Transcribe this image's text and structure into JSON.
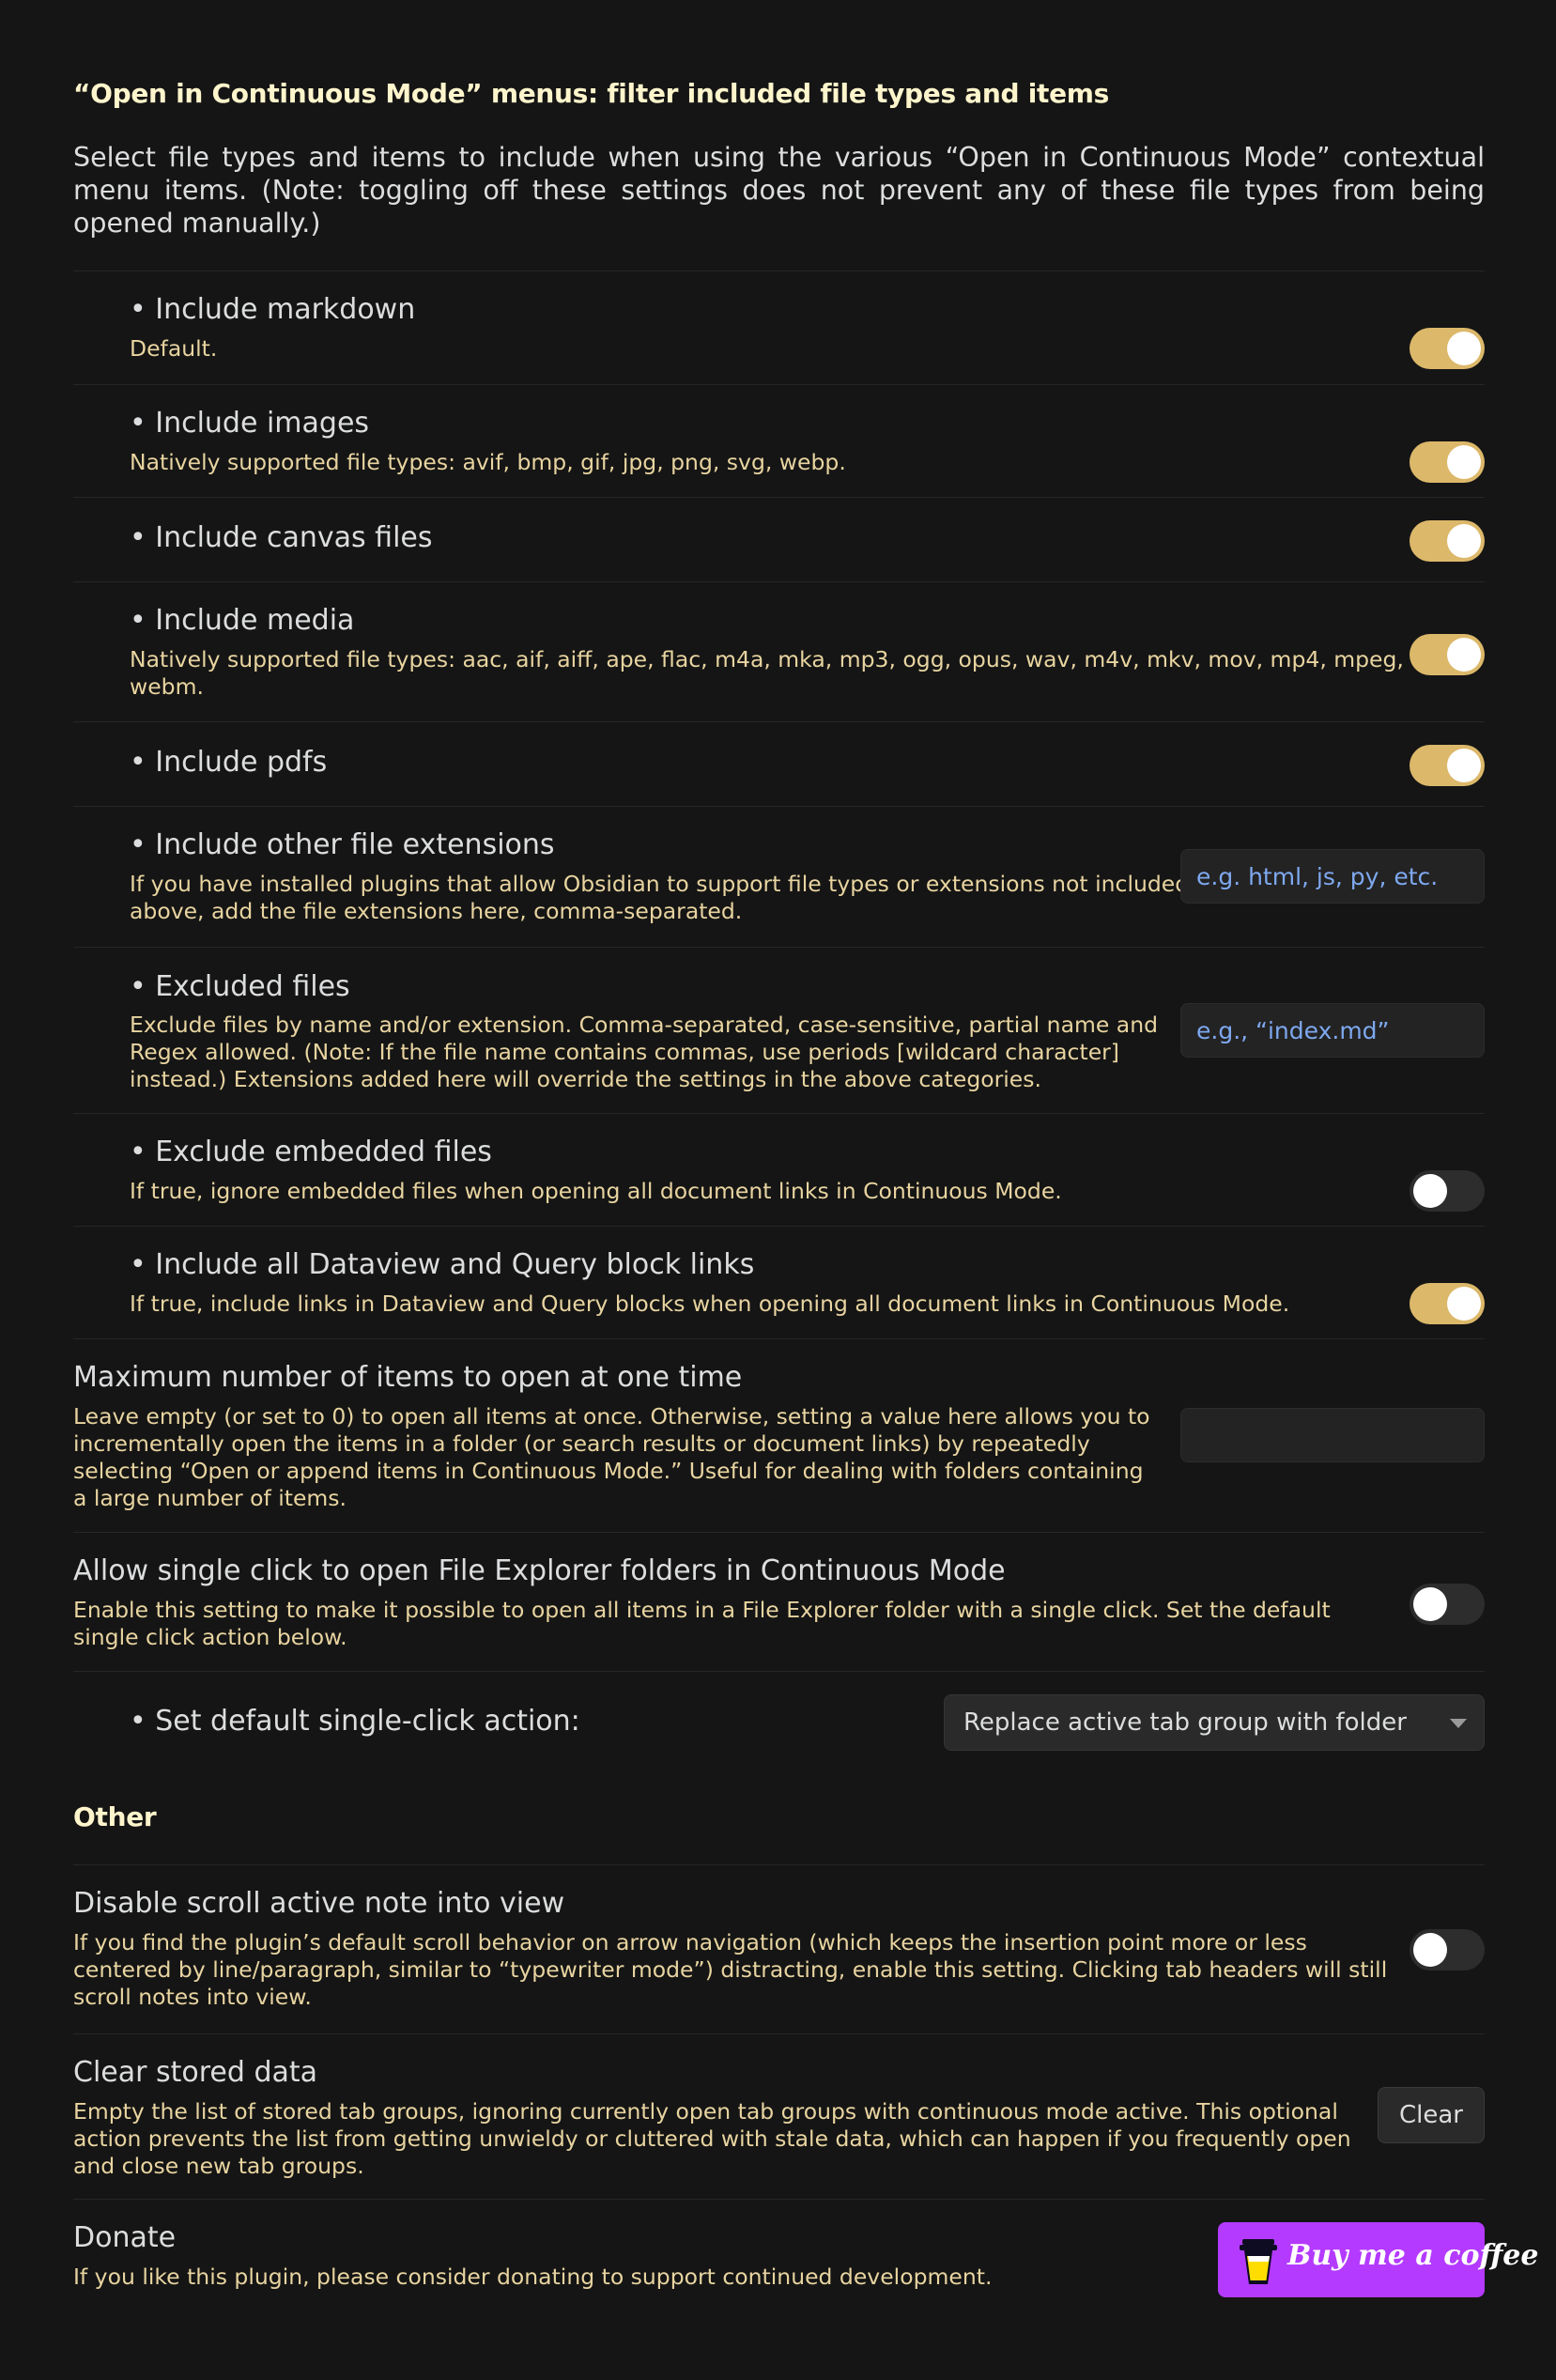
{
  "menus_section": {
    "heading": "“Open in Continuous Mode” menus: filter included file types and items",
    "intro": "Select file types and items to include when using the various “Open in Continuous Mode” contextual menu items. (Note: toggling off these settings does not prevent any of these file types from being opened manually.)"
  },
  "settings": {
    "markdown": {
      "name": "• Include markdown",
      "desc": "Default.",
      "enabled": true
    },
    "images": {
      "name": "• Include images",
      "desc": "Natively supported file types: avif, bmp, gif, jpg, png, svg, webp.",
      "enabled": true
    },
    "canvas": {
      "name": "• Include canvas files",
      "enabled": true
    },
    "media": {
      "name": "• Include media",
      "desc": "Natively supported file types: aac, aif, aiff, ape, flac, m4a, mka, mp3, ogg, opus, wav, m4v, mkv, mov, mp4, mpeg, webm.",
      "enabled": true
    },
    "pdfs": {
      "name": "• Include pdfs",
      "enabled": true
    },
    "other_extensions": {
      "name": "• Include other file extensions",
      "desc": "If you have installed plugins that allow Obsidian to support file types or extensions not included above, add the file extensions here, comma-separated.",
      "value": "",
      "placeholder": "e.g. html, js, py, etc."
    },
    "excluded_files": {
      "name": "• Excluded files",
      "desc": "Exclude files by name and/or extension. Comma-separated, case-sensitive, partial name and Regex allowed. (Note: If the file name contains commas, use periods [wildcard character] instead.) Extensions added here will override the settings in the above categories.",
      "value": "",
      "placeholder": "e.g., “index.md”"
    },
    "exclude_embedded": {
      "name": "• Exclude embedded files",
      "desc": "If true, ignore embedded files when opening all document links in Continuous Mode.",
      "enabled": false
    },
    "dataview_links": {
      "name": "• Include all Dataview and Query block links",
      "desc": "If true, include links in Dataview and Query blocks when opening all document links in Continuous Mode.",
      "enabled": true
    },
    "max_items": {
      "name": "Maximum number of items to open at one time",
      "desc": "Leave empty (or set to 0) to open all items at once. Otherwise, setting a value here allows you to incrementally open the items in a folder (or search results or document links) by repeatedly selecting “Open or append items in Continuous Mode.” Useful for dealing with folders containing a large number of items.",
      "value": "",
      "placeholder": ""
    },
    "single_click": {
      "name": "Allow single click to open File Explorer folders in Continuous Mode",
      "desc": "Enable this setting to make it possible to open all items in a File Explorer folder with a single click. Set the default single click action below.",
      "enabled": false
    },
    "default_action": {
      "name": "• Set default single-click action:",
      "selected": "Replace active tab group with folder"
    }
  },
  "other_section": {
    "heading": "Other",
    "disable_scroll": {
      "name": "Disable scroll active note into view",
      "desc": "If you find the plugin’s default scroll behavior on arrow navigation (which keeps the insertion point more or less centered by line/paragraph, similar to “typewriter mode”) distracting, enable this setting. Clicking tab headers will still scroll notes into view.",
      "enabled": false
    },
    "clear_data": {
      "name": "Clear stored data",
      "desc": "Empty the list of stored tab groups, ignoring currently open tab groups with continuous mode active. This optional action prevents the list from getting unwieldy or cluttered with stale data, which can happen if you frequently open and close new tab groups.",
      "button_label": "Clear"
    },
    "donate": {
      "name": "Donate",
      "desc": "If you like this plugin, please consider donating to support continued development.",
      "button_label": "Buy me a coffee"
    }
  },
  "colors": {
    "background": "#151515",
    "heading": "#fff5cc",
    "description": "#e8d4a0",
    "toggle_on": "#dcb86a",
    "toggle_off": "#2d2d2d",
    "placeholder": "#7ea8ef",
    "coffee_button": "#b43aff"
  }
}
